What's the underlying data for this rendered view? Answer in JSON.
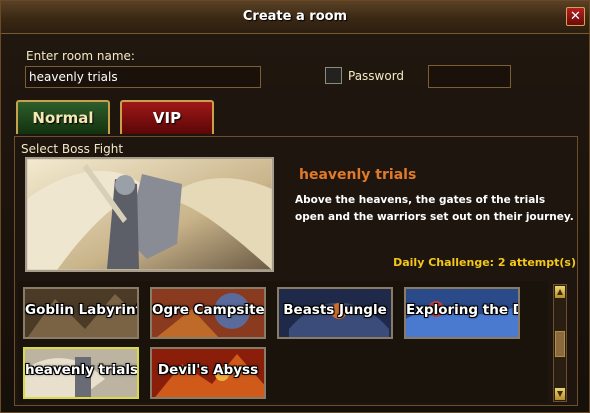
{
  "window": {
    "title": "Create a room",
    "close_icon": "close-icon"
  },
  "room": {
    "name_label": "Enter room name:",
    "name_value": "heavenly trials"
  },
  "password": {
    "label": "Password",
    "checked": false,
    "value": ""
  },
  "tabs": [
    {
      "label": "Normal",
      "active": true
    },
    {
      "label": "VIP",
      "active": false
    }
  ],
  "boss_section": {
    "label": "Select Boss Fight",
    "selected_name": "heavenly trials",
    "description": "Above the heavens, the gates of the trials open and the warriors set out on their journey.",
    "daily_challenge": "Daily Challenge: 2 attempt(s)"
  },
  "boss_list": [
    {
      "name": "Goblin Labyrint",
      "selected": false
    },
    {
      "name": "Ogre Campsite",
      "selected": false
    },
    {
      "name": "Beasts Jungle",
      "selected": false
    },
    {
      "name": "Exploring the D",
      "selected": false
    },
    {
      "name": "heavenly trials",
      "selected": true
    },
    {
      "name": "Devil's Abyss",
      "selected": false
    }
  ],
  "colors": {
    "accent_orange": "#e07a2a",
    "daily_yellow": "#f3c81a",
    "tab_green": "#2d5e2a",
    "tab_red": "#a01818",
    "selected_border": "#d9d94a"
  }
}
